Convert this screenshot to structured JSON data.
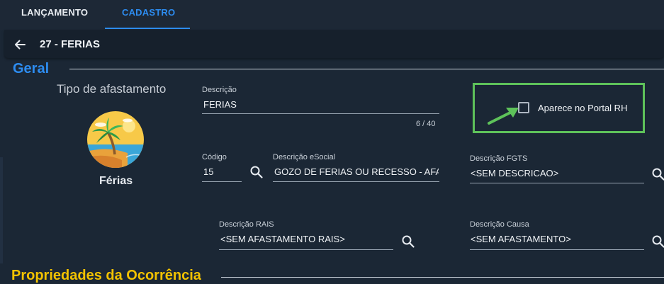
{
  "tabs": [
    {
      "label": "LANÇAMENTO",
      "active": false
    },
    {
      "label": "CADASTRO",
      "active": true
    }
  ],
  "header": {
    "title": "27 - FERIAS",
    "back_icon": "arrow-left-icon"
  },
  "sections": {
    "geral": "Geral",
    "propriedades": "Propriedades da Ocorrência"
  },
  "tipo": {
    "label": "Tipo de afastamento",
    "name": "Férias",
    "icon": "beach-palm-icon"
  },
  "fields": {
    "descricao": {
      "label": "Descrição",
      "value": "FERIAS",
      "counter": "6 / 40"
    },
    "codigo": {
      "label": "Código",
      "value": "15"
    },
    "descricao_esocial": {
      "label": "Descrição eSocial",
      "value": "GOZO DE FERIAS OU RECESSO - AFASTAMENTO"
    },
    "descricao_fgts": {
      "label": "Descrição FGTS",
      "value": "<SEM DESCRICAO>"
    },
    "descricao_rais": {
      "label": "Descrição RAIS",
      "value": "<SEM AFASTAMENTO RAIS>"
    },
    "descricao_causa": {
      "label": "Descrição Causa",
      "value": "<SEM AFASTAMENTO>"
    }
  },
  "portal": {
    "label": "Aparece no Portal RH",
    "checked": false
  },
  "colors": {
    "accent": "#2d8cf0",
    "section_yellow": "#f2c200",
    "highlight_green": "#5ec25a",
    "background": "#1b2735"
  }
}
